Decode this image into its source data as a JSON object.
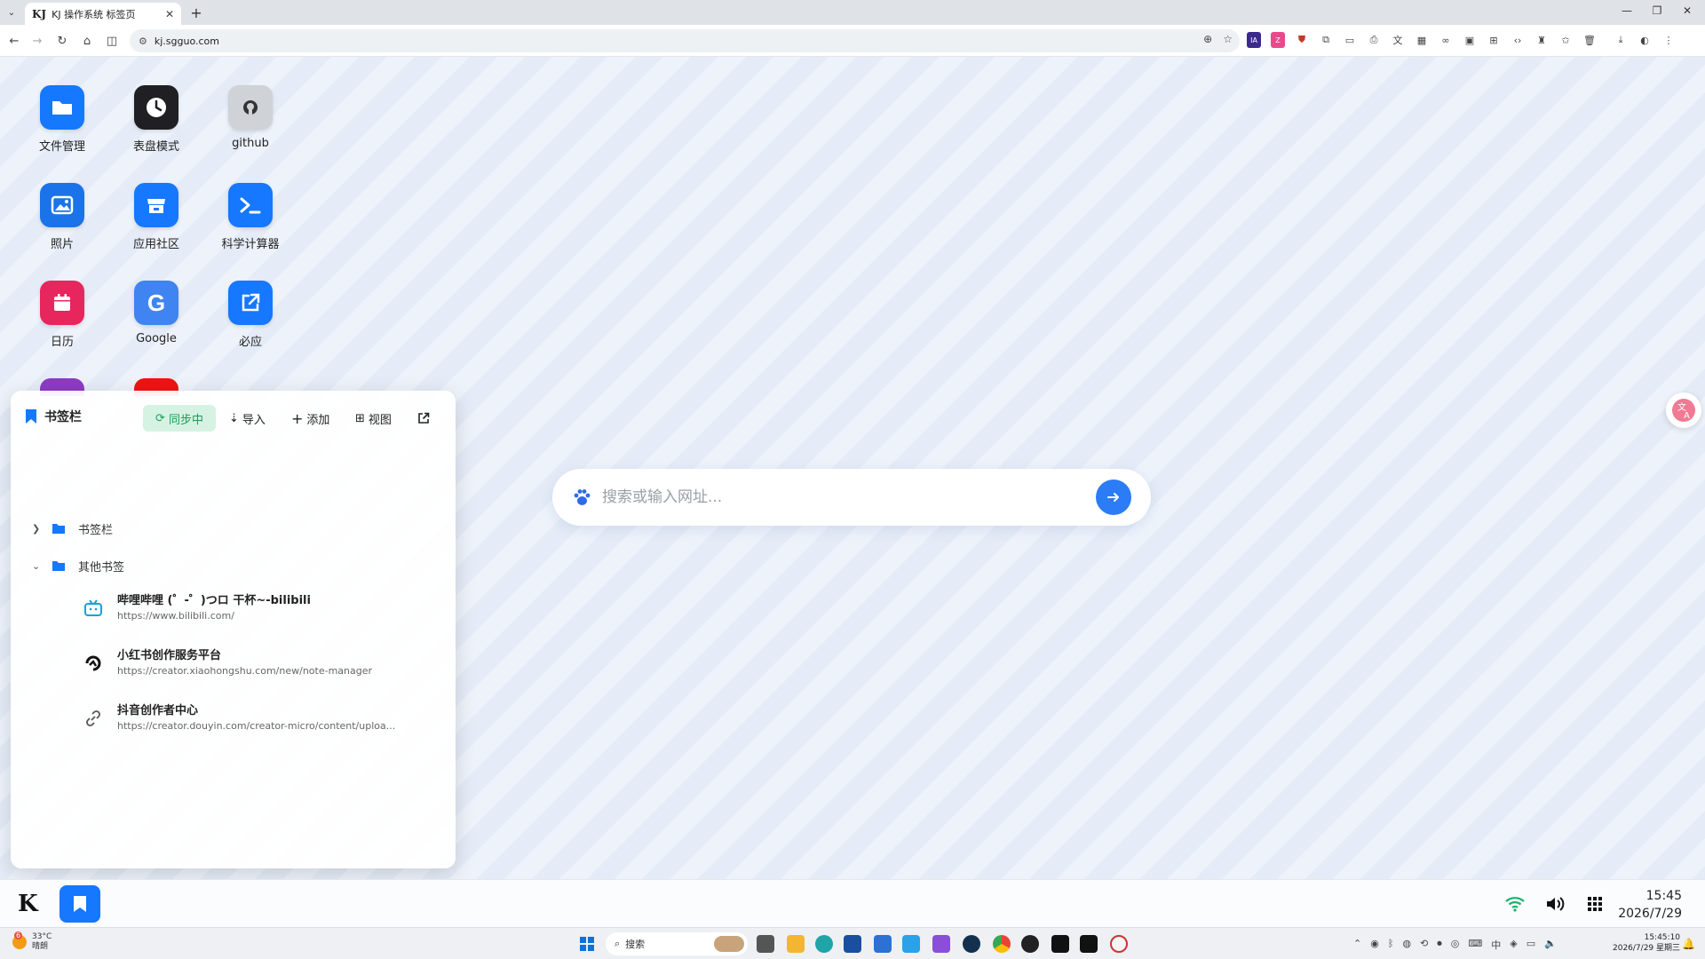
{
  "browser": {
    "tab_title": "KJ 操作系统 标签页",
    "tab_favicon": "KJ",
    "url": "kj.sgguo.com"
  },
  "apps": [
    {
      "label": "文件管理",
      "icon": "folder-icon",
      "color": "#1677ff"
    },
    {
      "label": "表盘模式",
      "icon": "clock-icon",
      "color": "#1f1f24"
    },
    {
      "label": "github",
      "icon": "github-icon",
      "color": "#cfd2d6"
    },
    {
      "label": "照片",
      "icon": "photo-icon",
      "color": "#1a73e8"
    },
    {
      "label": "应用社区",
      "icon": "store-icon",
      "color": "#1677ff"
    },
    {
      "label": "科学计算器",
      "icon": "terminal-icon",
      "color": "#1677ff"
    },
    {
      "label": "日历",
      "icon": "calendar-icon",
      "color": "#e8265e"
    },
    {
      "label": "Google",
      "icon": "google-icon",
      "color": "#3f84f0"
    },
    {
      "label": "必应",
      "icon": "external-link-icon",
      "color": "#1677ff"
    }
  ],
  "bookmark_panel": {
    "title": "书签栏",
    "sync_label": "同步中",
    "import_label": "导入",
    "add_label": "添加",
    "view_label": "视图",
    "folders": [
      {
        "name": "书签栏",
        "expanded": false
      },
      {
        "name": "其他书签",
        "expanded": true
      }
    ],
    "items": [
      {
        "name": "哔哩哔哩 (゜-゜)つロ 干杯~-bilibili",
        "url": "https://www.bilibili.com/",
        "icon": "bilibili-icon"
      },
      {
        "name": "小红书创作服务平台",
        "url": "https://creator.xiaohongshu.com/new/note-manager",
        "icon": "xiaohongshu-icon"
      },
      {
        "name": "抖音创作者中心",
        "url": "https://creator.douyin.com/creator-micro/content/uploa...",
        "icon": "link-icon"
      }
    ]
  },
  "search": {
    "placeholder": "搜索或输入网址..."
  },
  "dock": {
    "logo": "K",
    "time": "15:45",
    "date": "2026/7/29"
  },
  "windows_taskbar": {
    "weather_temp": "33°C",
    "weather_desc": "晴朗",
    "weather_badge": "6",
    "search_label": "搜索",
    "clock_time": "15:45:10",
    "clock_date": "2026/7/29 星期三"
  },
  "colors": {
    "accent": "#1677ff",
    "sync_green": "#18a058"
  }
}
